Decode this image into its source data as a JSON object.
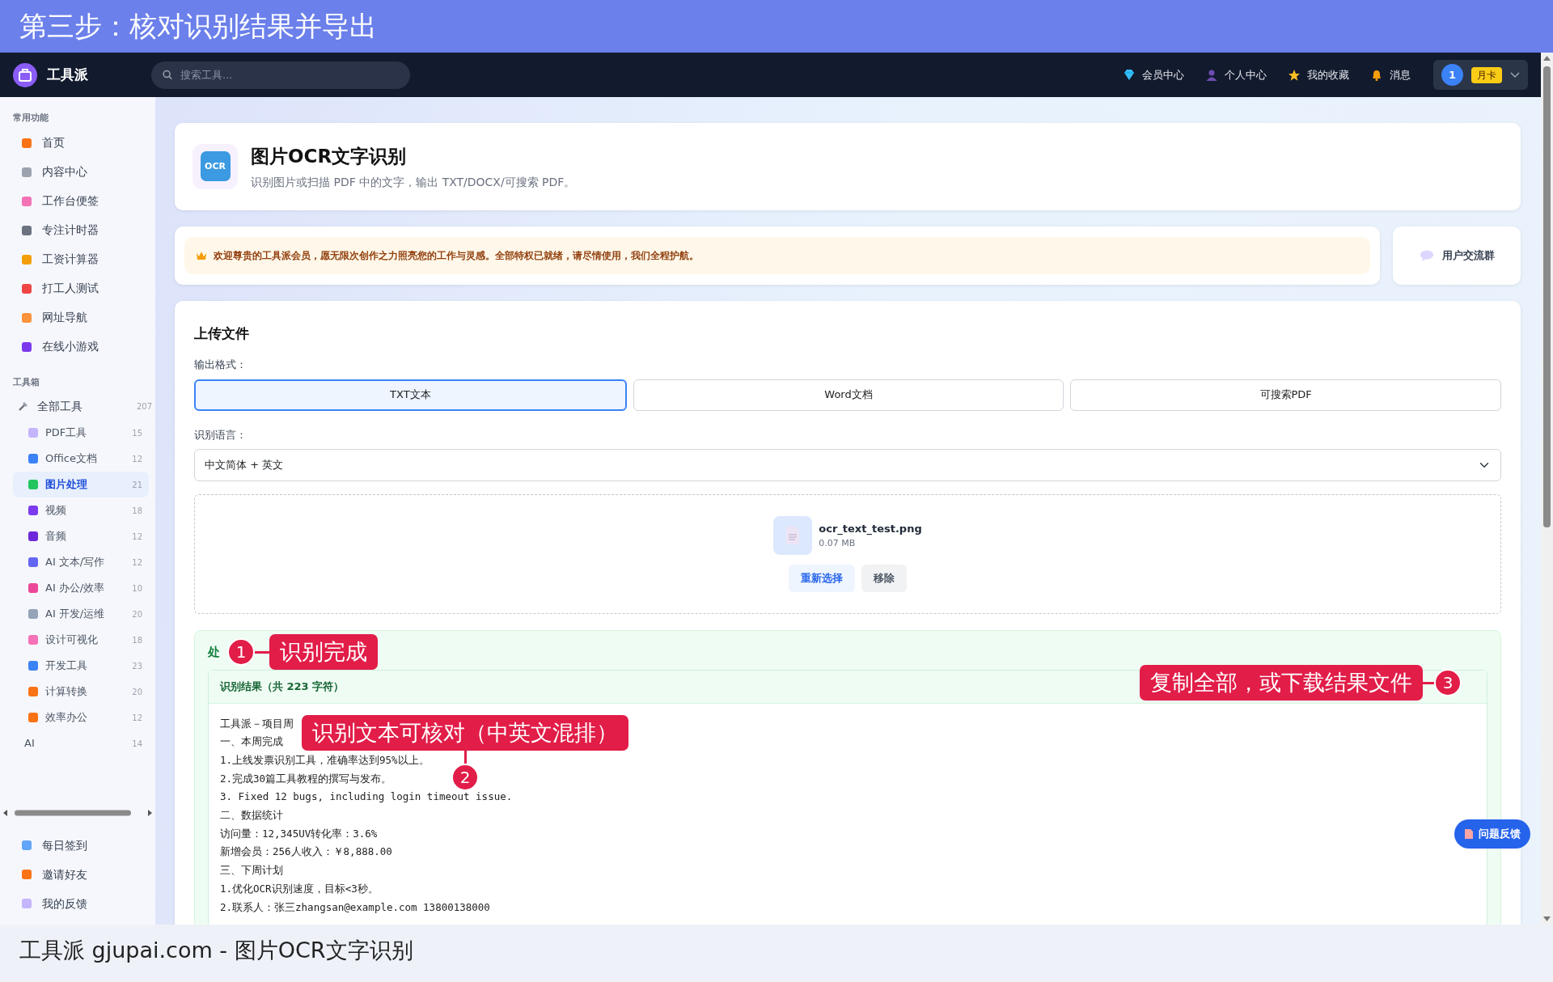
{
  "banner": {
    "title": "第三步：核对识别结果并导出"
  },
  "navbar": {
    "brand": "工具派",
    "search": {
      "placeholder": "搜索工具..."
    },
    "links": [
      {
        "label": "会员中心"
      },
      {
        "label": "个人中心"
      },
      {
        "label": "我的收藏"
      },
      {
        "label": "消息"
      }
    ],
    "user": {
      "avatar": "1",
      "badge": "月卡"
    }
  },
  "sidebar": {
    "sections": [
      {
        "title": "常用功能",
        "items": [
          {
            "label": "首页"
          },
          {
            "label": "内容中心"
          },
          {
            "label": "工作台便签"
          },
          {
            "label": "专注计时器"
          },
          {
            "label": "工资计算器"
          },
          {
            "label": "打工人测试"
          },
          {
            "label": "网址导航"
          },
          {
            "label": "在线小游戏"
          }
        ]
      },
      {
        "title": "工具箱",
        "items": [
          {
            "label": "全部工具",
            "count": "207",
            "children": [
              {
                "label": "PDF工具",
                "count": "15",
                "selected": false,
                "kind": "icon"
              },
              {
                "label": "Office文档",
                "count": "12",
                "selected": false,
                "kind": "icon"
              },
              {
                "label": "图片处理",
                "count": "21",
                "selected": true,
                "kind": "icon"
              },
              {
                "label": "视频",
                "count": "18",
                "selected": false,
                "kind": "icon"
              },
              {
                "label": "音频",
                "count": "12",
                "selected": false,
                "kind": "icon"
              },
              {
                "label": "AI 文本/写作",
                "count": "12",
                "selected": false,
                "kind": "icon"
              },
              {
                "label": "AI 办公/效率",
                "count": "10",
                "selected": false,
                "kind": "icon"
              },
              {
                "label": "AI 开发/运维",
                "count": "20",
                "selected": false,
                "kind": "icon"
              },
              {
                "label": "设计可视化",
                "count": "18",
                "selected": false,
                "kind": "icon"
              },
              {
                "label": "开发工具",
                "count": "23",
                "selected": false,
                "kind": "icon"
              },
              {
                "label": "计算转换",
                "count": "20",
                "selected": false,
                "kind": "icon"
              },
              {
                "label": "效率办公",
                "count": "12",
                "selected": false,
                "kind": "icon"
              },
              {
                "label": "AI",
                "count": "14",
                "selected": false,
                "kind": "plain"
              }
            ]
          }
        ]
      }
    ],
    "footer_items": [
      {
        "label": "每日签到"
      },
      {
        "label": "邀请好友"
      },
      {
        "label": "我的反馈"
      }
    ]
  },
  "tool": {
    "icon": "OCR",
    "title": "图片OCR文字识别",
    "subtitle": "识别图片或扫描 PDF 中的文字，输出 TXT/DOCX/可搜索 PDF。"
  },
  "notice": {
    "text": "欢迎尊贵的工具派会员，愿无限次创作之力照亮您的工作与灵感。全部特权已就绪，请尽情使用，我们全程护航。"
  },
  "community": {
    "label": "用户交流群"
  },
  "upload": {
    "title": "上传文件",
    "format_label": "输出格式：",
    "formats": [
      {
        "label": "TXT文本",
        "selected": true
      },
      {
        "label": "Word文档",
        "selected": false
      },
      {
        "label": "可搜索PDF",
        "selected": false
      }
    ],
    "language_label": "识别语言：",
    "language": "中文简体 + 英文",
    "file": {
      "name": "ocr_text_test.png",
      "size": "0.07 MB"
    },
    "buttons": [
      {
        "label": "重新选择",
        "kind": "primary"
      },
      {
        "label": "移除",
        "kind": "secondary"
      }
    ]
  },
  "result": {
    "status": "处",
    "header": "识别结果（共 223 字符）",
    "lines": [
      "工具派－项目周",
      "一、本周完成",
      "1.上线发票识别工具，准确率达到95%以上。",
      "2.完成30篇工具教程的撰写与发布。",
      "3. Fixed 12 bugs, including login timeout issue.",
      "二、数据统计",
      "访问量：12,345UV转化率：3.6%",
      "新增会员：256人收入：￥8,888.00",
      "三、下周计划",
      "1.优化OCR识别速度，目标<3秒。",
      "2.联系人：张三zhangsan@example.com 13800138000"
    ]
  },
  "callouts": [
    {
      "number": "1",
      "text": "识别完成"
    },
    {
      "number": "2",
      "text": "识别文本可核对（中英文混排）"
    },
    {
      "number": "3",
      "text": "复制全部，或下载结果文件"
    }
  ],
  "feedback_button": "问题反馈",
  "caption": "工具派 gjupai.com - 图片OCR文字识别"
}
